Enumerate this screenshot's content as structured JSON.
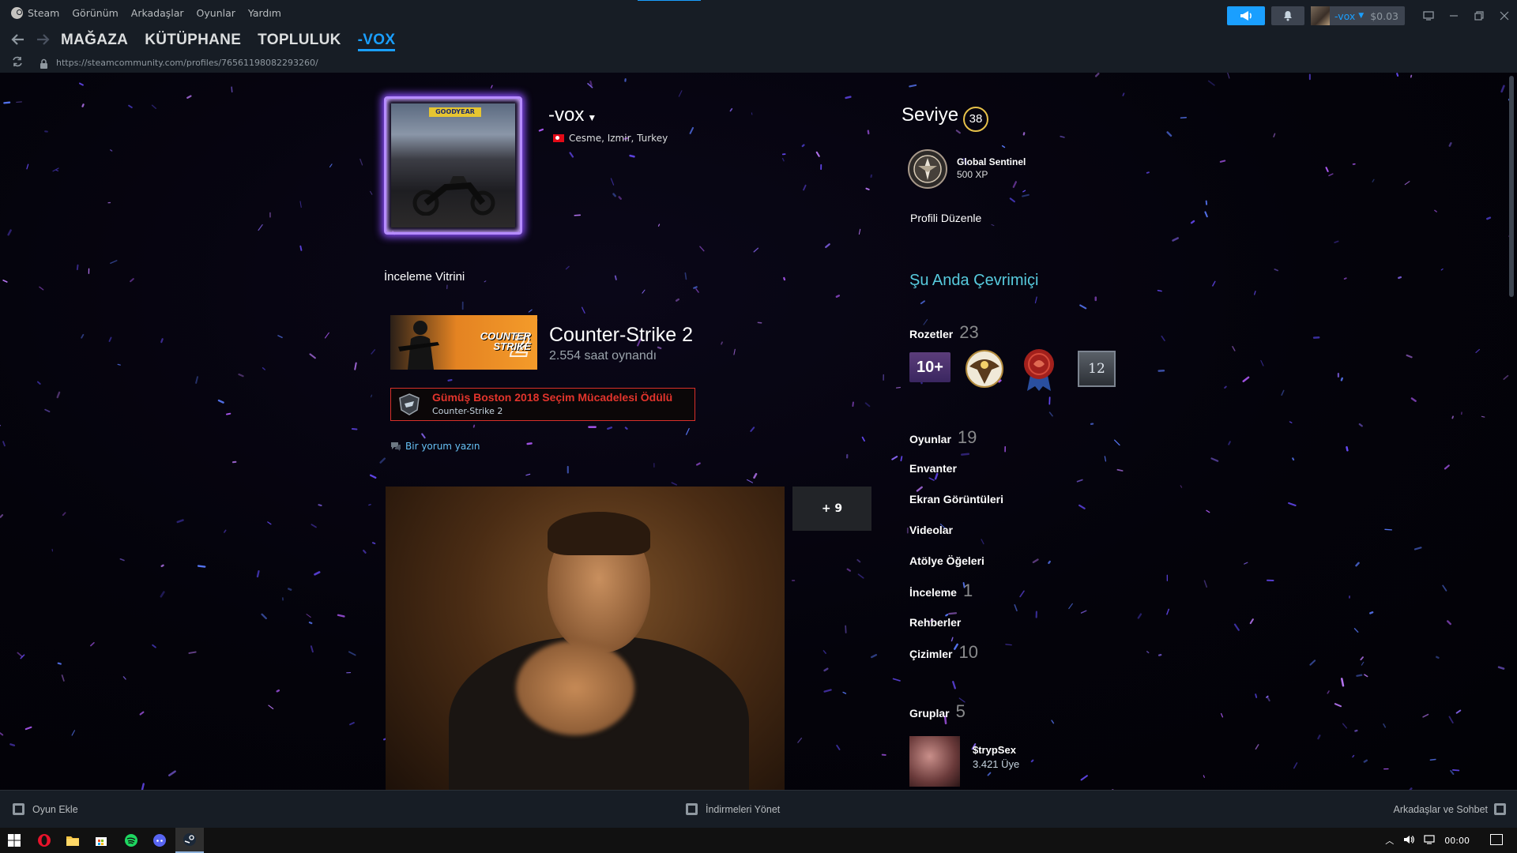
{
  "menu": {
    "app_name": "Steam",
    "items": [
      "Görünüm",
      "Arkadaşlar",
      "Oyunlar",
      "Yardım"
    ]
  },
  "account": {
    "name": "-vox",
    "balance": "$0.03"
  },
  "nav": {
    "links": [
      "MAĞAZA",
      "KÜTÜPHANE",
      "TOPLULUK",
      "-VOX"
    ],
    "active_index": 3
  },
  "urlbar": {
    "url": "https://steamcommunity.com/profiles/76561198082293260/"
  },
  "profile": {
    "avatar_sign": "GOODYEAR",
    "persona_name": "-vox",
    "location": "Cesme, Izmir, Turkey"
  },
  "showcase": {
    "title": "İnceleme Vitrini",
    "game_capsule_text": [
      "COUNTER",
      "STRIKE"
    ],
    "game_name": "Counter-Strike 2",
    "game_hours": "2.554 saat oynandı",
    "award_title": "Gümüş Boston 2018 Seçim Mücadelesi Ödülü",
    "award_game": "Counter-Strike 2",
    "comment_link": "Bir yorum yazın",
    "more_count": "+ 9"
  },
  "sidebar": {
    "level_label": "Seviye",
    "level_value": "38",
    "fav_badge_name": "Global Sentinel",
    "fav_badge_xp": "500 XP",
    "edit_profile": "Profili Düzenle",
    "online_status": "Şu Anda Çevrimiçi",
    "badges_label": "Rozetler",
    "badges_count": "23",
    "badge_10_text": "10+",
    "badge_12_text": "12",
    "stats": [
      {
        "label": "Oyunlar",
        "count": "19"
      },
      {
        "label": "Envanter",
        "count": ""
      },
      {
        "label": "Ekran Görüntüleri",
        "count": ""
      },
      {
        "label": "Videolar",
        "count": ""
      },
      {
        "label": "Atölye Öğeleri",
        "count": ""
      },
      {
        "label": "İnceleme",
        "count": "1"
      },
      {
        "label": "Rehberler",
        "count": ""
      },
      {
        "label": "Çizimler",
        "count": "10"
      }
    ],
    "groups_label": "Gruplar",
    "groups_count": "5",
    "group": {
      "name": "$trypSex",
      "members": "3.421 Üye"
    }
  },
  "bottombar": {
    "add_game": "Oyun Ekle",
    "downloads": "İndirmeleri Yönet",
    "friends_chat": "Arkadaşlar ve Sohbet"
  },
  "taskbar": {
    "clock": "00:00"
  },
  "colors": {
    "accent": "#1a9fff",
    "online": "#57cbde",
    "award_red": "#e2342c",
    "avatar_glow": "#8b4dff"
  }
}
